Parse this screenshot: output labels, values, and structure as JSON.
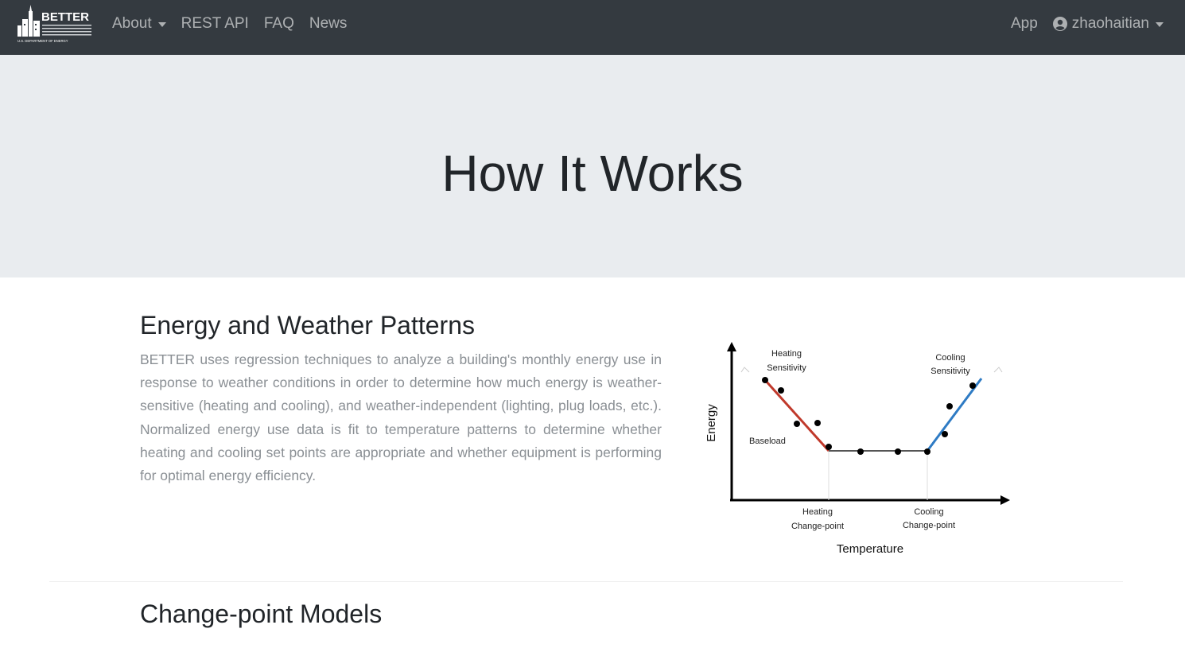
{
  "navbar": {
    "brand_name": "BETTER",
    "brand_sub": "U.S. DEPARTMENT OF ENERGY",
    "links": [
      {
        "label": "About",
        "dropdown": true
      },
      {
        "label": "REST API",
        "dropdown": false
      },
      {
        "label": "FAQ",
        "dropdown": false
      },
      {
        "label": "News",
        "dropdown": false
      }
    ],
    "app_label": "App",
    "user_label": "zhaohaitian"
  },
  "hero": {
    "title": "How It Works"
  },
  "section1": {
    "title": "Energy and Weather Patterns",
    "body": "BETTER uses regression techniques to analyze a building's monthly energy use in response to weather conditions in order to determine how much energy is weather-sensitive (heating and cooling), and weather-independent (lighting, plug loads, etc.). Normalized energy use data is fit to temperature patterns to determine whether heating and cooling set points are appropriate and whether equipment is performing for optimal energy efficiency."
  },
  "figure": {
    "y_label": "Energy",
    "x_label": "Temperature",
    "heating_sensitivity_1": "Heating",
    "heating_sensitivity_2": "Sensitivity",
    "cooling_sensitivity_1": "Cooling",
    "cooling_sensitivity_2": "Sensitivity",
    "baseload": "Baseload",
    "heating_cp_1": "Heating",
    "heating_cp_2": "Change-point",
    "cooling_cp_1": "Cooling",
    "cooling_cp_2": "Change-point",
    "heating_color": "#c0392b",
    "cooling_color": "#2e7bc4",
    "baseload_color": "#555555"
  },
  "section2": {
    "title": "Change-point Models"
  }
}
